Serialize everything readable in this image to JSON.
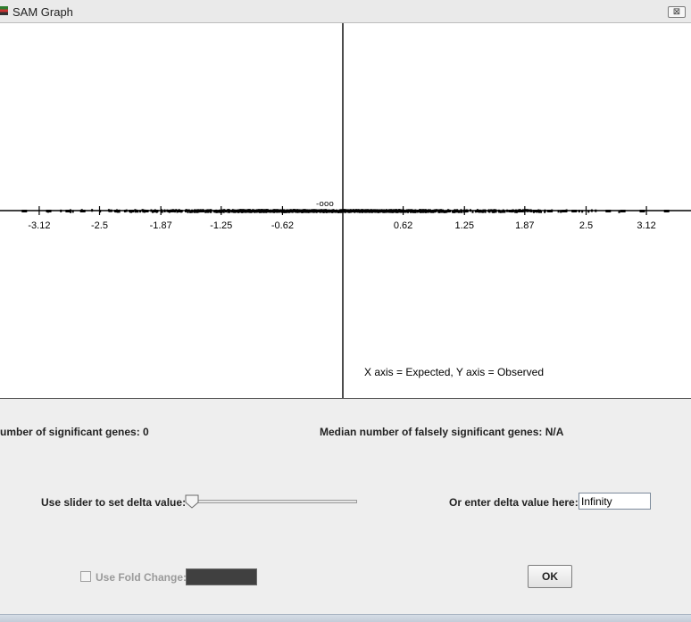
{
  "window": {
    "title": "SAM Graph",
    "close_glyph": "⊠"
  },
  "graph": {
    "legend": "X axis = Expected, Y axis = Observed",
    "small_label": "-ooo",
    "chart_data": {
      "type": "scatter",
      "x_ticks": [
        -3.12,
        -2.5,
        -1.87,
        -1.25,
        -0.62,
        0.62,
        1.25,
        1.87,
        2.5,
        3.12
      ],
      "x_tick_labels": [
        "-3.12",
        "-2.5",
        "-1.87",
        "-1.25",
        "-0.62",
        "0.62",
        "1.25",
        "1.87",
        "2.5",
        "3.12"
      ],
      "xlim": [
        -3.55,
        3.55
      ],
      "grid": false
    }
  },
  "stats": {
    "significant_genes": "umber of significant genes: 0",
    "median_false": "Median number of falsely significant genes: N/A"
  },
  "controls": {
    "slider_label": "Use slider to set delta value:",
    "slider_value": 0,
    "delta_label": "Or enter delta value here:",
    "delta_value": "Infinity",
    "fold_label": "Use Fold Change:",
    "fold_checked": false,
    "ok_label": "OK"
  }
}
